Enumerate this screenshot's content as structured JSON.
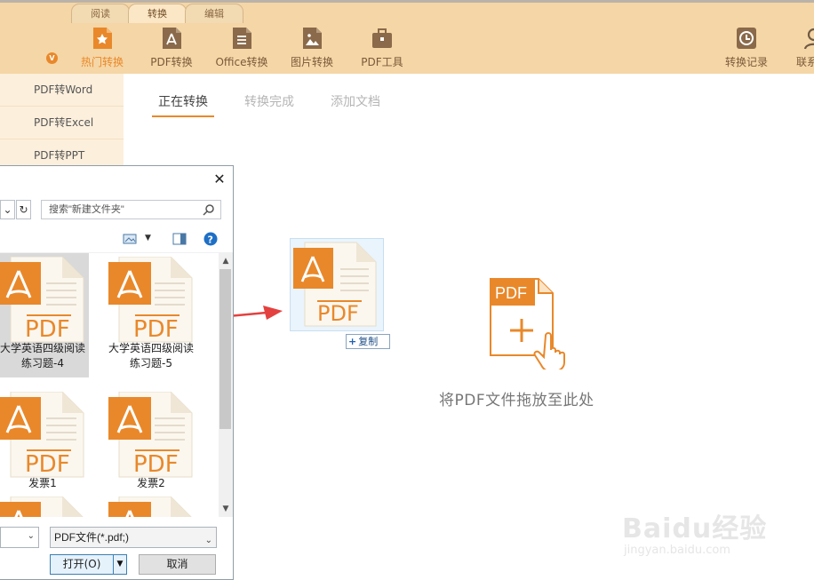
{
  "menu_tabs": [
    {
      "label": "阅读",
      "active": false
    },
    {
      "label": "转换",
      "active": true
    },
    {
      "label": "编辑",
      "active": false
    }
  ],
  "toolbar": [
    {
      "label": "热门转换",
      "icon": "star-doc-icon",
      "active": true
    },
    {
      "label": "PDF转换",
      "icon": "pdf-doc-icon",
      "active": false
    },
    {
      "label": "Office转换",
      "icon": "office-doc-icon",
      "active": false
    },
    {
      "label": "图片转换",
      "icon": "image-doc-icon",
      "active": false
    },
    {
      "label": "PDF工具",
      "icon": "toolbox-icon",
      "active": false
    }
  ],
  "toolbar_right": [
    {
      "label": "转换记录",
      "icon": "clock-icon"
    },
    {
      "label": "联系",
      "icon": "user-icon"
    }
  ],
  "vip_badge": "V",
  "sidebar": {
    "items": [
      "PDF转Word",
      "PDF转Excel",
      "PDF转PPT"
    ]
  },
  "content_tabs": [
    {
      "label": "正在转换",
      "active": true
    },
    {
      "label": "转换完成",
      "active": false
    },
    {
      "label": "添加文档",
      "active": false
    }
  ],
  "drop_zone": {
    "icon_label": "PDF",
    "text": "将PDF文件拖放至此处"
  },
  "drag_ghost": {
    "file_icon_label": "PDF",
    "copy_label": "复制"
  },
  "dialog": {
    "search_placeholder": "搜索\"新建文件夹\"",
    "files": [
      {
        "label": "大学英语四级阅读练习题-4",
        "selected": true
      },
      {
        "label": "大学英语四级阅读练习题-5",
        "selected": false
      },
      {
        "label": "发票1",
        "selected": false
      },
      {
        "label": "发票2",
        "selected": false
      }
    ],
    "file_type_filter": "PDF文件(*.pdf;)",
    "open_label": "打开(O)",
    "cancel_label": "取消",
    "close_glyph": "✕"
  },
  "watermark": {
    "text": "Baidu经验",
    "sub": "jingyan.baidu.com"
  },
  "colors": {
    "accent": "#e9882a",
    "toolbar_bg": "#f5d6a6",
    "sidebar_bg": "#fcefdc",
    "arrow": "#e3413f"
  }
}
